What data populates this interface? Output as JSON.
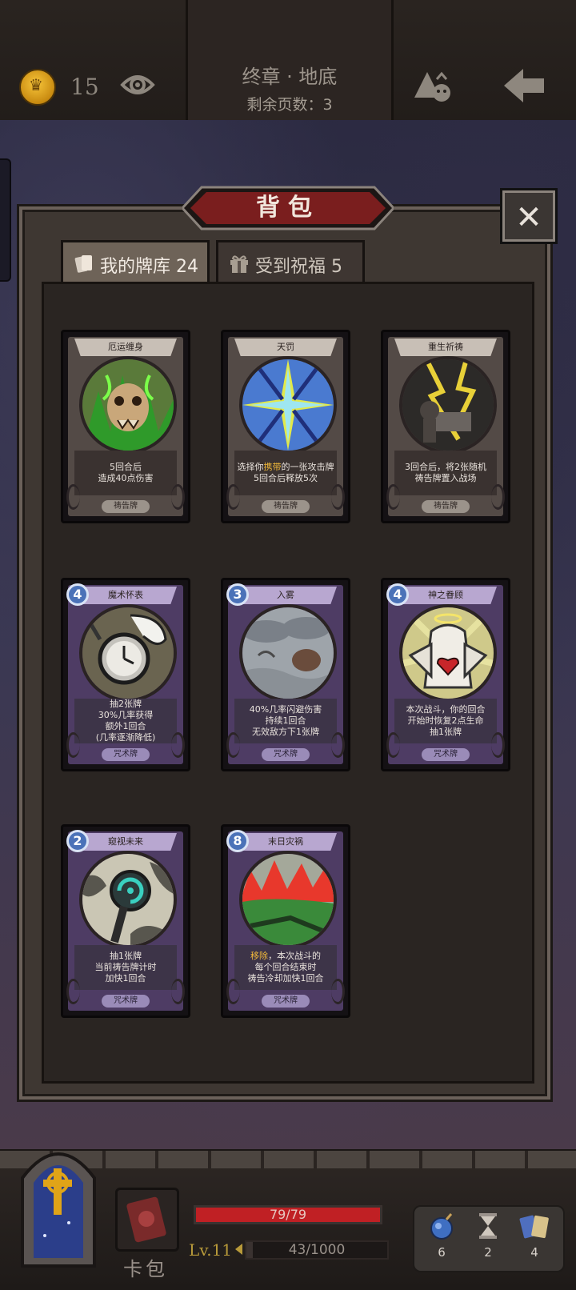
{
  "header": {
    "gold": "15",
    "chapter_title": "终章 · 地底",
    "pages_left": "剩余页数：3"
  },
  "panel": {
    "title": "背包",
    "close_label": "✕",
    "tabs": [
      {
        "label": "我的牌库 24",
        "active": true
      },
      {
        "label": "受到祝福 5",
        "active": false
      }
    ]
  },
  "cards": [
    {
      "name": "厄运缠身",
      "type": "祷告牌",
      "cost": "",
      "desc": [
        "5回合后",
        "造成40点伤害"
      ],
      "kind": "prayer",
      "art": "curse"
    },
    {
      "name": "天罚",
      "type": "祷告牌",
      "cost": "",
      "desc_pre": "选择你",
      "desc_hl": "携带",
      "desc_post": "的一张攻击牌",
      "desc": [
        "5回合后释放5次"
      ],
      "kind": "prayer",
      "art": "lightning"
    },
    {
      "name": "重生祈祷",
      "type": "祷告牌",
      "cost": "",
      "desc": [
        "3回合后，将2张随机",
        "祷告牌置入战场"
      ],
      "kind": "prayer",
      "art": "rebirth"
    },
    {
      "name": "魔术怀表",
      "type": "咒术牌",
      "cost": "4",
      "desc": [
        "抽2张牌",
        "30%几率获得",
        "额外1回合",
        "(几率逐渐降低)"
      ],
      "kind": "spell",
      "art": "watch"
    },
    {
      "name": "入雾",
      "type": "咒术牌",
      "cost": "3",
      "desc": [
        "40%几率闪避伤害",
        "持续1回合",
        "无效敌方下1张牌"
      ],
      "kind": "spell",
      "art": "fog"
    },
    {
      "name": "神之眷顾",
      "type": "咒术牌",
      "cost": "4",
      "desc": [
        "本次战斗，你的回合",
        "开始时恢复2点生命",
        "抽1张牌"
      ],
      "kind": "spell",
      "art": "angel"
    },
    {
      "name": "窥视未来",
      "type": "咒术牌",
      "cost": "2",
      "desc": [
        "抽1张牌",
        "当前祷告牌计时",
        "加快1回合"
      ],
      "kind": "spell",
      "art": "future"
    },
    {
      "name": "末日灾祸",
      "type": "咒术牌",
      "cost": "8",
      "desc_pre": "",
      "desc_hl": "移除",
      "desc_post": "，本次战斗的",
      "desc": [
        "每个回合结束时",
        "祷告冷却加快1回合"
      ],
      "kind": "spell",
      "art": "doom"
    }
  ],
  "footer": {
    "cardpack_label": "卡包",
    "hp_text": "79/79",
    "hp_fraction": 1.0,
    "level": "Lv.11",
    "xp_text": "43/1000",
    "xp_fraction": 0.043,
    "resources": [
      {
        "icon": "bomb-icon",
        "count": "6"
      },
      {
        "icon": "hourglass-icon",
        "count": "2"
      },
      {
        "icon": "cards-icon",
        "count": "4"
      }
    ]
  },
  "colors": {
    "hp_red": "#c02024",
    "cost_blue": "#4b72b8",
    "highlight_gold": "#f0b83a",
    "spell_purple": "#4e3c64"
  }
}
